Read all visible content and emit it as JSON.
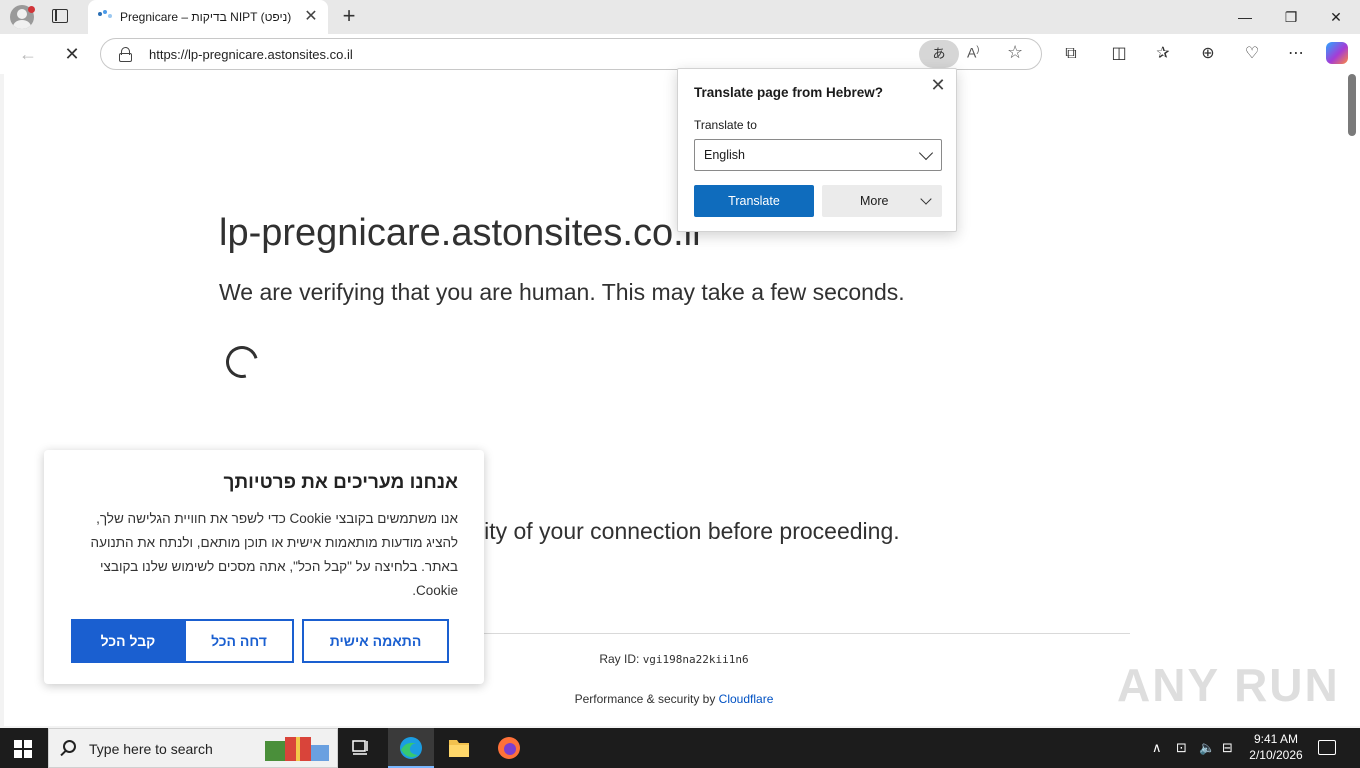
{
  "browser": {
    "tab": {
      "title": "Pregnicare – בדיקות NIPT (ניפט) מ"
    },
    "window_controls": {
      "minimize": "—",
      "restore": "❐",
      "close": "✕"
    },
    "address": {
      "url": "https://lp-pregnicare.astonsites.co.il"
    },
    "translate_icon": "あ"
  },
  "translate_popup": {
    "title": "Translate page from Hebrew?",
    "label": "Translate to",
    "language": "English",
    "translate_button": "Translate",
    "more_button": "More"
  },
  "page": {
    "domain": "lp-pregnicare.astonsites.co.il",
    "verifying": "We are verifying that you are human. This may take a few seconds.",
    "needs_review": "needs to review the security of your connection before proceeding.",
    "ray_label": "Ray ID: ",
    "ray_id": "vgi198na22kii1n6",
    "perf_text": "Performance & security by ",
    "perf_link": "Cloudflare",
    "watermark": "ANY RUN"
  },
  "cookie_banner": {
    "title": "אנחנו מעריכים את פרטיותך",
    "body": "אנו משתמשים בקובצי Cookie כדי לשפר את חוויית הגלישה שלך, להציג מודעות מותאמות אישית או תוכן מותאם, ולנתח את התנועה באתר. בלחיצה על \"קבל הכל\", אתה מסכים לשימוש שלנו בקובצי Cookie.",
    "accept_all": "קבל הכל",
    "reject_all": "דחה הכל",
    "customize": "התאמה אישית"
  },
  "taskbar": {
    "search_placeholder": "Type here to search",
    "time": "9:41 AM",
    "date": "2/10/2026"
  }
}
